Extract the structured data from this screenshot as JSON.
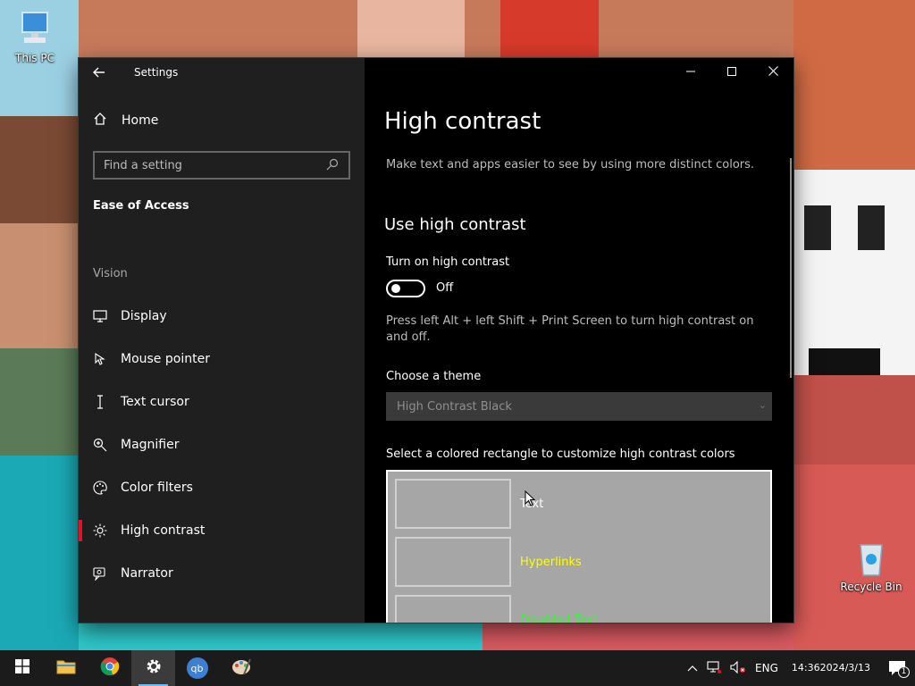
{
  "desktop": {
    "icons": [
      {
        "label": "This PC",
        "icon": "this-pc-icon"
      },
      {
        "label": "Recycle Bin",
        "icon": "recycle-bin-icon"
      }
    ]
  },
  "window": {
    "title": "Settings",
    "caption": {
      "minimize": "minimize-icon",
      "maximize": "maximize-icon",
      "close": "close-icon"
    }
  },
  "nav": {
    "home_label": "Home",
    "search_placeholder": "Find a setting",
    "section": "Ease of Access",
    "group": "Vision",
    "items": [
      {
        "label": "Display",
        "icon": "display-icon",
        "selected": false
      },
      {
        "label": "Mouse pointer",
        "icon": "mouse-pointer-icon",
        "selected": false
      },
      {
        "label": "Text cursor",
        "icon": "text-cursor-icon",
        "selected": false
      },
      {
        "label": "Magnifier",
        "icon": "magnifier-icon",
        "selected": false
      },
      {
        "label": "Color filters",
        "icon": "color-filters-icon",
        "selected": false
      },
      {
        "label": "High contrast",
        "icon": "high-contrast-icon",
        "selected": true
      },
      {
        "label": "Narrator",
        "icon": "narrator-icon",
        "selected": false
      }
    ]
  },
  "content": {
    "title": "High contrast",
    "description": "Make text and apps easier to see by using more distinct colors.",
    "use_heading": "Use high contrast",
    "toggle_label": "Turn on high contrast",
    "toggle_state": "Off",
    "shortcut_note": "Press left Alt + left Shift + Print Screen to turn high contrast on and off.",
    "theme_label": "Choose a theme",
    "theme_value": "High Contrast Black",
    "colors_label": "Select a colored rectangle to customize high contrast colors",
    "color_items": [
      {
        "label": "Text",
        "color": "#ffffff"
      },
      {
        "label": "Hyperlinks",
        "color": "#ffff00"
      },
      {
        "label": "Disabled Text",
        "color": "#3ff23f"
      }
    ]
  },
  "taskbar": {
    "apps": [
      {
        "name": "start",
        "icon": "windows-start-icon"
      },
      {
        "name": "file-explorer",
        "icon": "file-explorer-icon"
      },
      {
        "name": "chrome",
        "icon": "chrome-icon"
      },
      {
        "name": "settings",
        "icon": "gear-icon"
      },
      {
        "name": "qbittorrent",
        "icon": "qbittorrent-icon",
        "text": "qb"
      },
      {
        "name": "paint",
        "icon": "paint-icon"
      }
    ],
    "tray": {
      "language": "ENG",
      "time": "14:36",
      "date": "2024/3/13",
      "notifications": "1"
    }
  },
  "colors": {
    "accent": "#e81123",
    "nav_bg": "#1f1f1f",
    "content_bg": "#000000",
    "panel_bg": "#a6a6a6"
  }
}
